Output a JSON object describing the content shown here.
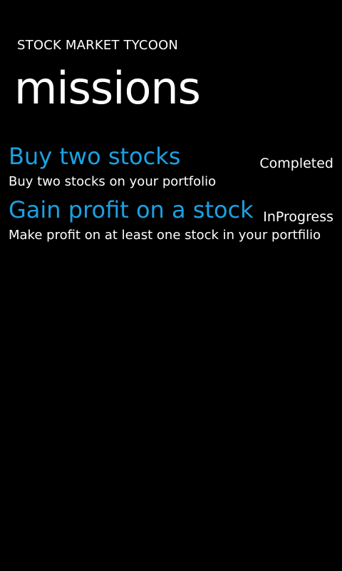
{
  "header": {
    "app_title": "STOCK MARKET TYCOON",
    "page_title": "missions"
  },
  "missions": [
    {
      "title": "Buy two stocks",
      "description": "Buy two stocks on your portfolio",
      "status": "Completed"
    },
    {
      "title": "Gain profit on a stock",
      "description": "Make profit on at least one stock in your portfilio",
      "status": "InProgress"
    }
  ],
  "colors": {
    "background": "#000000",
    "accent": "#1ba1e2",
    "text": "#ffffff"
  }
}
